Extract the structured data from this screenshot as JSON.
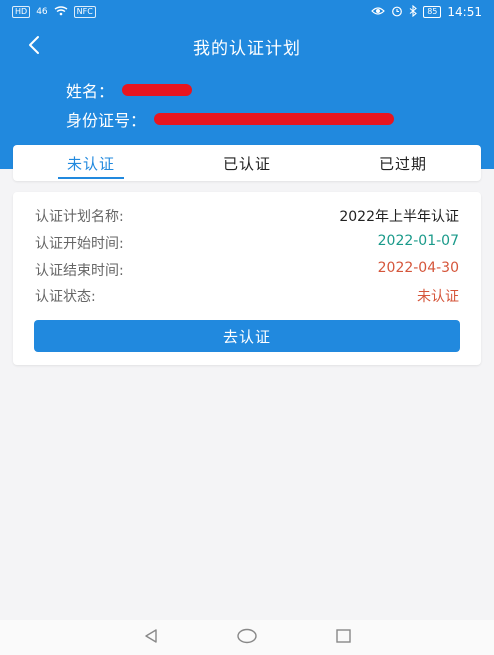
{
  "status_bar": {
    "hd_label": "HD",
    "network_label": "46",
    "wifi_icon": "wifi-icon",
    "nfc_label": "NFC",
    "icons": [
      "eye-icon",
      "alarm-icon",
      "bluetooth-icon"
    ],
    "battery": "85",
    "time": "14:51"
  },
  "header": {
    "back_icon": "chevron-left-icon",
    "title": "我的认证计划",
    "name_label": "姓名：",
    "id_label": "身份证号："
  },
  "tabs": [
    {
      "label": "未认证",
      "active": true
    },
    {
      "label": "已认证",
      "active": false
    },
    {
      "label": "已过期",
      "active": false
    }
  ],
  "card": {
    "plan_name_label": "认证计划名称:",
    "plan_name_value": "2022年上半年认证",
    "start_label": "认证开始时间:",
    "start_value": "2022-01-07",
    "end_label": "认证结束时间:",
    "end_value": "2022-04-30",
    "status_label": "认证状态:",
    "status_value": "未认证",
    "action_label": "去认证"
  },
  "colors": {
    "primary": "#2189de",
    "start_date": "#1a9a8a",
    "warning": "#d5563b",
    "redaction": "#e8151f"
  },
  "nav_bar": [
    "back-triangle-icon",
    "home-circle-icon",
    "recents-square-icon"
  ]
}
